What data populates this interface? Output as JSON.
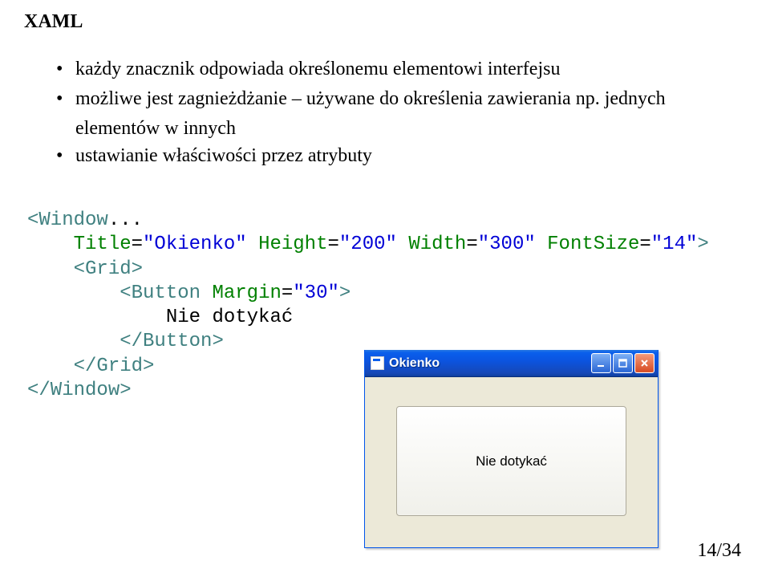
{
  "heading": "XAML",
  "bullets": {
    "b1": "każdy znacznik odpowiada określonemu elementowi interfejsu",
    "b2a": "możliwe jest zagnieżdżanie – używane do określenia zawierania np. jednych",
    "b2b": "elementów w innych",
    "b3": "ustawianie właściwości przez atrybuty"
  },
  "code": {
    "line1_tag": "<Window",
    "line1_ell": "...",
    "line2_prefix": "    ",
    "line2_a1": "Title",
    "line2_v1": "\"Okienko\"",
    "line2_a2": "Height",
    "line2_v2": "\"200\"",
    "line2_a3": "Width",
    "line2_v3": "\"300\"",
    "line2_a4": "FontSize",
    "line2_v4": "\"14\"",
    "line2_close": ">",
    "line3_prefix": "    ",
    "line3_tag": "<Grid>",
    "line4_prefix": "        ",
    "line4_tag": "<Button",
    "line4_space": " ",
    "line4_attr": "Margin",
    "line4_val": "\"30\"",
    "line4_close": ">",
    "line5_prefix": "            ",
    "line5_text": "Nie dotykać",
    "line6_prefix": "        ",
    "line6_tag": "</Button>",
    "line7_prefix": "    ",
    "line7_tag": "</Grid>",
    "line8_tag": "</Window>"
  },
  "window": {
    "title": "Okienko",
    "button_text": "Nie dotykać"
  },
  "page": "14/34"
}
